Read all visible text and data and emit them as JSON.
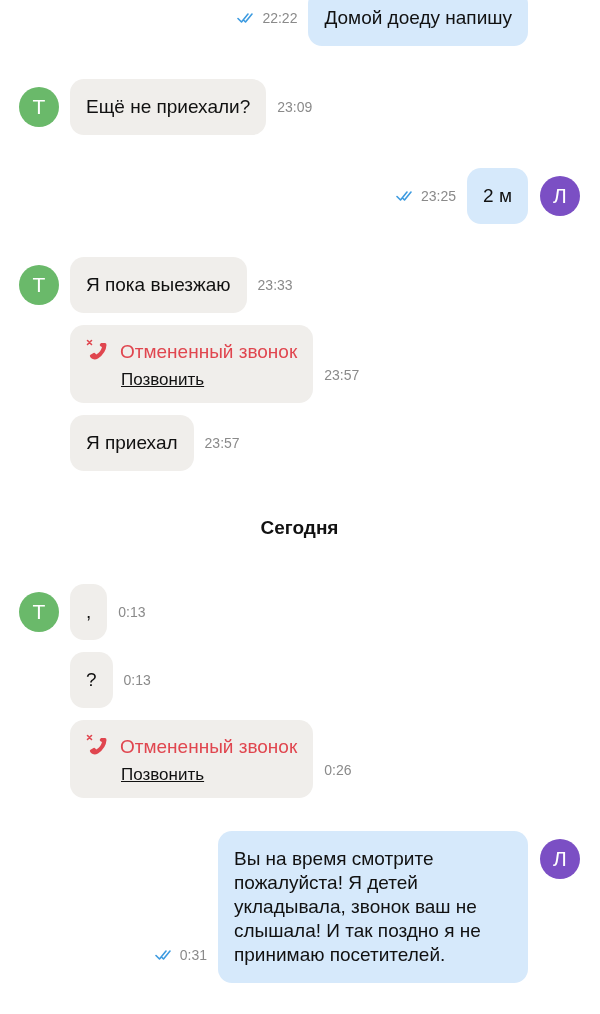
{
  "messages": [
    {
      "kind": "text",
      "outgoing": true,
      "text": "Домой доеду напишу",
      "time": "22:22",
      "read": true
    },
    {
      "kind": "text",
      "outgoing": false,
      "avatar": "Т",
      "text": "Ещё не приехали?",
      "time": "23:09"
    },
    {
      "kind": "text",
      "outgoing": true,
      "avatar": "Л",
      "text": "2 м",
      "time": "23:25",
      "read": true
    },
    {
      "kind": "text",
      "outgoing": false,
      "avatar": "Т",
      "text": "Я пока выезжаю",
      "time": "23:33"
    },
    {
      "kind": "call",
      "outgoing": false,
      "title": "Отмененный звонок",
      "action": "Позвонить",
      "time": "23:57"
    },
    {
      "kind": "text",
      "outgoing": false,
      "text": "Я приехал",
      "time": "23:57"
    },
    {
      "kind": "date",
      "text": "Сегодня"
    },
    {
      "kind": "text",
      "outgoing": false,
      "avatar": "Т",
      "text": ",",
      "time": "0:13"
    },
    {
      "kind": "text",
      "outgoing": false,
      "text": "?",
      "time": "0:13"
    },
    {
      "kind": "call",
      "outgoing": false,
      "title": "Отмененный звонок",
      "action": "Позвонить",
      "time": "0:26"
    },
    {
      "kind": "text",
      "outgoing": true,
      "avatar": "Л",
      "text": "Вы на время смотрите пожалуйста! Я детей укладывала, звонок ваш не слышала! И так поздно я не принимаю посетителей.",
      "time": "0:31",
      "read": true
    }
  ]
}
